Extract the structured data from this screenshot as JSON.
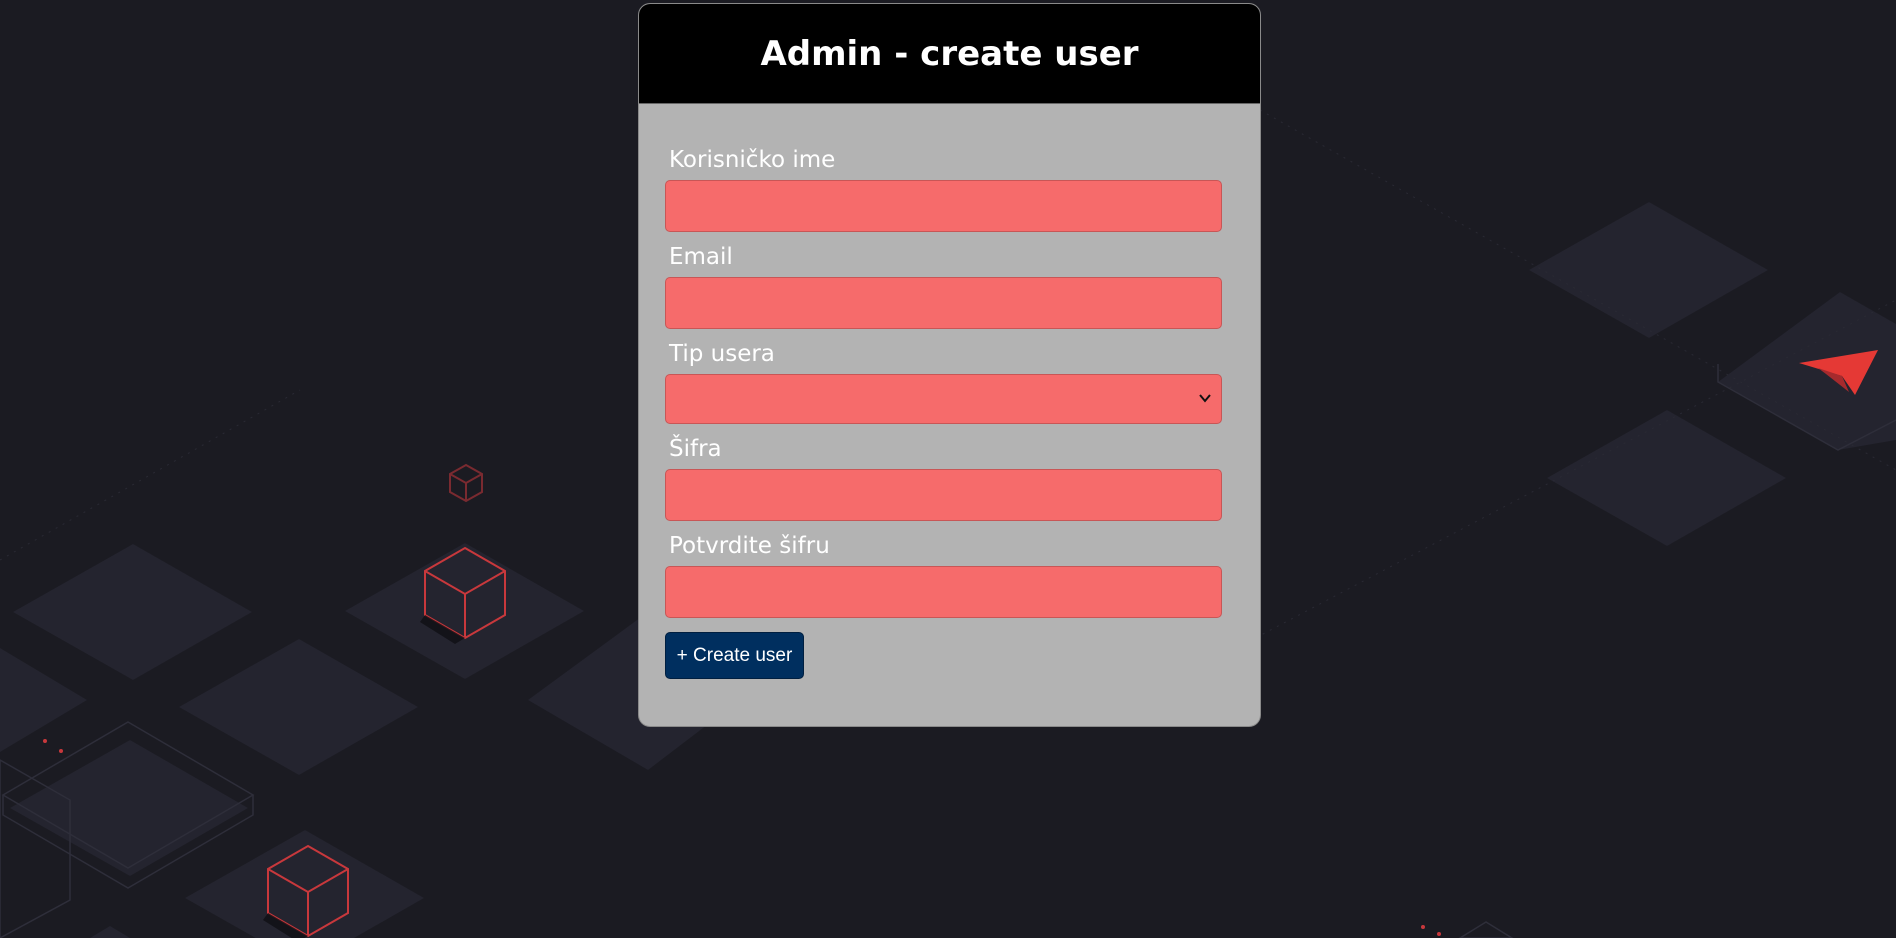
{
  "header": {
    "title": "Admin - create user"
  },
  "form": {
    "fields": [
      {
        "label": "Korisničko ime",
        "value": ""
      },
      {
        "label": "Email",
        "value": ""
      },
      {
        "label": "Tip usera",
        "value": ""
      },
      {
        "label": "Šifra",
        "value": ""
      },
      {
        "label": "Potvrdite šifru",
        "value": ""
      }
    ],
    "submit_label": "+ Create user"
  },
  "colors": {
    "page_background": "#1b1b22",
    "card_background": "#b3b3b3",
    "header_background": "#000000",
    "input_background": "#f66b6b",
    "button_background": "#002f5f",
    "accent_red": "#e53935"
  },
  "icons": {
    "select_chevron": "chevron-down-icon",
    "brand_logo": "paper-plane-logo-icon"
  }
}
